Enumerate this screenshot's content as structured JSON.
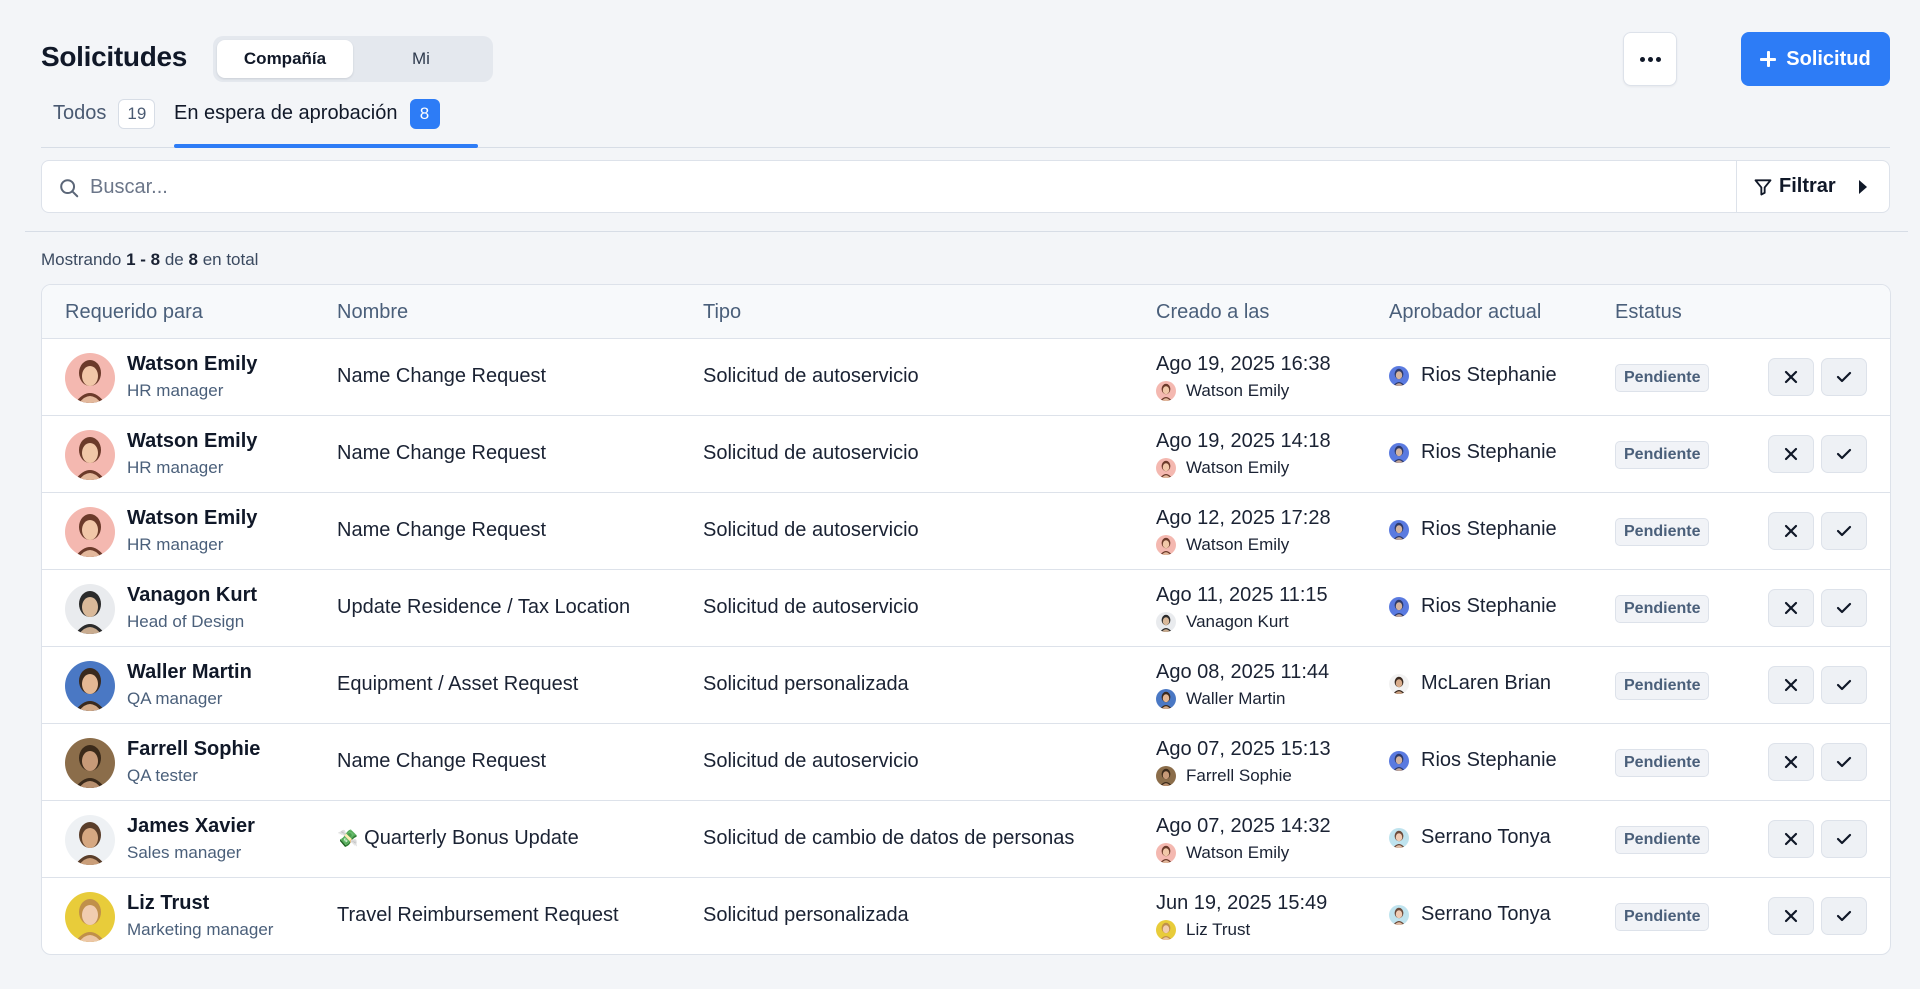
{
  "header": {
    "title": "Solicitudes",
    "segments": [
      "Compañía",
      "Mi"
    ],
    "new_label": "Solicitud"
  },
  "tabs": [
    {
      "label": "Todos",
      "count": "19"
    },
    {
      "label": "En espera de aprobación",
      "count": "8"
    }
  ],
  "search": {
    "placeholder": "Buscar...",
    "filter_label": "Filtrar"
  },
  "summary": {
    "prefix": "Mostrando",
    "range": "1 - 8",
    "of": "de",
    "total": "8",
    "suffix": "en total"
  },
  "columns": [
    "Requerido para",
    "Nombre",
    "Tipo",
    "Creado a las",
    "Aprobador actual",
    "Estatus"
  ],
  "colors": {
    "accent": "#2d7cf6",
    "text": "#101828",
    "muted": "#4a5f7a"
  },
  "rows": [
    {
      "person": "Watson Emily",
      "role": "HR manager",
      "name": "Name Change Request",
      "type": "Solicitud de autoservicio",
      "created": "Ago 19, 2025 16:38",
      "created_by": "Watson Emily",
      "approver": "Rios Stephanie",
      "status": "Pendiente"
    },
    {
      "person": "Watson Emily",
      "role": "HR manager",
      "name": "Name Change Request",
      "type": "Solicitud de autoservicio",
      "created": "Ago 19, 2025 14:18",
      "created_by": "Watson Emily",
      "approver": "Rios Stephanie",
      "status": "Pendiente"
    },
    {
      "person": "Watson Emily",
      "role": "HR manager",
      "name": "Name Change Request",
      "type": "Solicitud de autoservicio",
      "created": "Ago 12, 2025 17:28",
      "created_by": "Watson Emily",
      "approver": "Rios Stephanie",
      "status": "Pendiente"
    },
    {
      "person": "Vanagon Kurt",
      "role": "Head of Design",
      "name": "Update Residence / Tax Location",
      "type": "Solicitud de autoservicio",
      "created": "Ago 11, 2025 11:15",
      "created_by": "Vanagon Kurt",
      "approver": "Rios Stephanie",
      "status": "Pendiente"
    },
    {
      "person": "Waller Martin",
      "role": "QA manager",
      "name": "Equipment / Asset Request",
      "type": "Solicitud personalizada",
      "created": "Ago 08, 2025 11:44",
      "created_by": "Waller Martin",
      "approver": "McLaren Brian",
      "status": "Pendiente"
    },
    {
      "person": "Farrell Sophie",
      "role": "QA tester",
      "name": "Name Change Request",
      "type": "Solicitud de autoservicio",
      "created": "Ago 07, 2025 15:13",
      "created_by": "Farrell Sophie",
      "approver": "Rios Stephanie",
      "status": "Pendiente"
    },
    {
      "person": "James Xavier",
      "role": "Sales manager",
      "name": "Quarterly Bonus Update",
      "name_emoji": "💸",
      "type": "Solicitud de cambio de datos de personas",
      "created": "Ago 07, 2025 14:32",
      "created_by": "Watson Emily",
      "approver": "Serrano Tonya",
      "status": "Pendiente"
    },
    {
      "person": "Liz Trust",
      "role": "Marketing manager",
      "name": "Travel Reimbursement Request",
      "type": "Solicitud personalizada",
      "created": "Jun 19, 2025 15:49",
      "created_by": "Liz Trust",
      "approver": "Serrano Tonya",
      "status": "Pendiente"
    }
  ]
}
